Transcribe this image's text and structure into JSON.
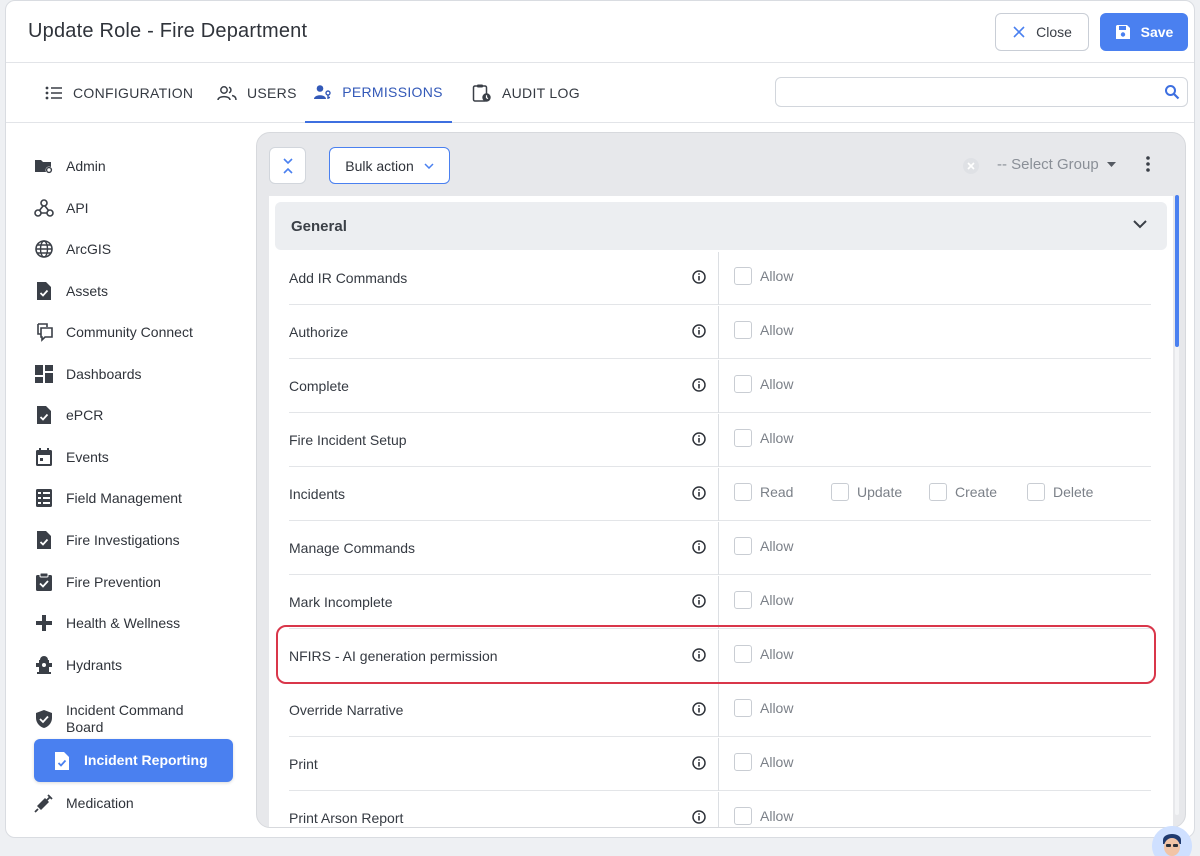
{
  "header": {
    "title": "Update Role - Fire Department",
    "close_label": "Close",
    "save_label": "Save"
  },
  "tabs": [
    {
      "label": "CONFIGURATION",
      "icon": "list-icon"
    },
    {
      "label": "USERS",
      "icon": "users-icon"
    },
    {
      "label": "PERMISSIONS",
      "icon": "user-key-icon",
      "active": true
    },
    {
      "label": "AUDIT LOG",
      "icon": "clipboard-clock-icon"
    }
  ],
  "search": {
    "value": "",
    "placeholder": ""
  },
  "sidebar": {
    "items": [
      {
        "label": "Admin",
        "icon": "folder-gear-icon"
      },
      {
        "label": "API",
        "icon": "webhook-icon"
      },
      {
        "label": "ArcGIS",
        "icon": "globe-icon"
      },
      {
        "label": "Assets",
        "icon": "document-check-icon"
      },
      {
        "label": "Community Connect",
        "icon": "chat-icon"
      },
      {
        "label": "Dashboards",
        "icon": "dashboard-icon"
      },
      {
        "label": "ePCR",
        "icon": "document-check-icon"
      },
      {
        "label": "Events",
        "icon": "calendar-icon"
      },
      {
        "label": "Field Management",
        "icon": "form-icon"
      },
      {
        "label": "Fire Investigations",
        "icon": "document-check-icon"
      },
      {
        "label": "Fire Prevention",
        "icon": "clipboard-check-icon"
      },
      {
        "label": "Health & Wellness",
        "icon": "plus-icon"
      },
      {
        "label": "Hydrants",
        "icon": "hydrant-icon"
      },
      {
        "label": "Incident Command Board",
        "icon": "shield-check-icon"
      },
      {
        "label": "Incident Reporting",
        "icon": "document-check-icon",
        "active": true
      },
      {
        "label": "Medication",
        "icon": "syringe-icon"
      }
    ]
  },
  "panel": {
    "bulk_action_label": "Bulk action",
    "select_group_label": "-- Select Group",
    "section_title": "General",
    "allow_label": "Allow",
    "permissions": [
      {
        "name": "Add IR Commands",
        "options": [
          "Allow"
        ]
      },
      {
        "name": "Authorize",
        "options": [
          "Allow"
        ]
      },
      {
        "name": "Complete",
        "options": [
          "Allow"
        ]
      },
      {
        "name": "Fire Incident Setup",
        "options": [
          "Allow"
        ]
      },
      {
        "name": "Incidents",
        "options": [
          "Read",
          "Update",
          "Create",
          "Delete"
        ]
      },
      {
        "name": "Manage Commands",
        "options": [
          "Allow"
        ]
      },
      {
        "name": "Mark Incomplete",
        "options": [
          "Allow"
        ]
      },
      {
        "name": "NFIRS - AI generation permission",
        "options": [
          "Allow"
        ],
        "highlighted": true
      },
      {
        "name": "Override Narrative",
        "options": [
          "Allow"
        ]
      },
      {
        "name": "Print",
        "options": [
          "Allow"
        ]
      },
      {
        "name": "Print Arson Report",
        "options": [
          "Allow"
        ]
      }
    ]
  },
  "colors": {
    "accent": "#4a80f0",
    "active_tab": "#3359b8",
    "highlight": "#d9364a"
  }
}
